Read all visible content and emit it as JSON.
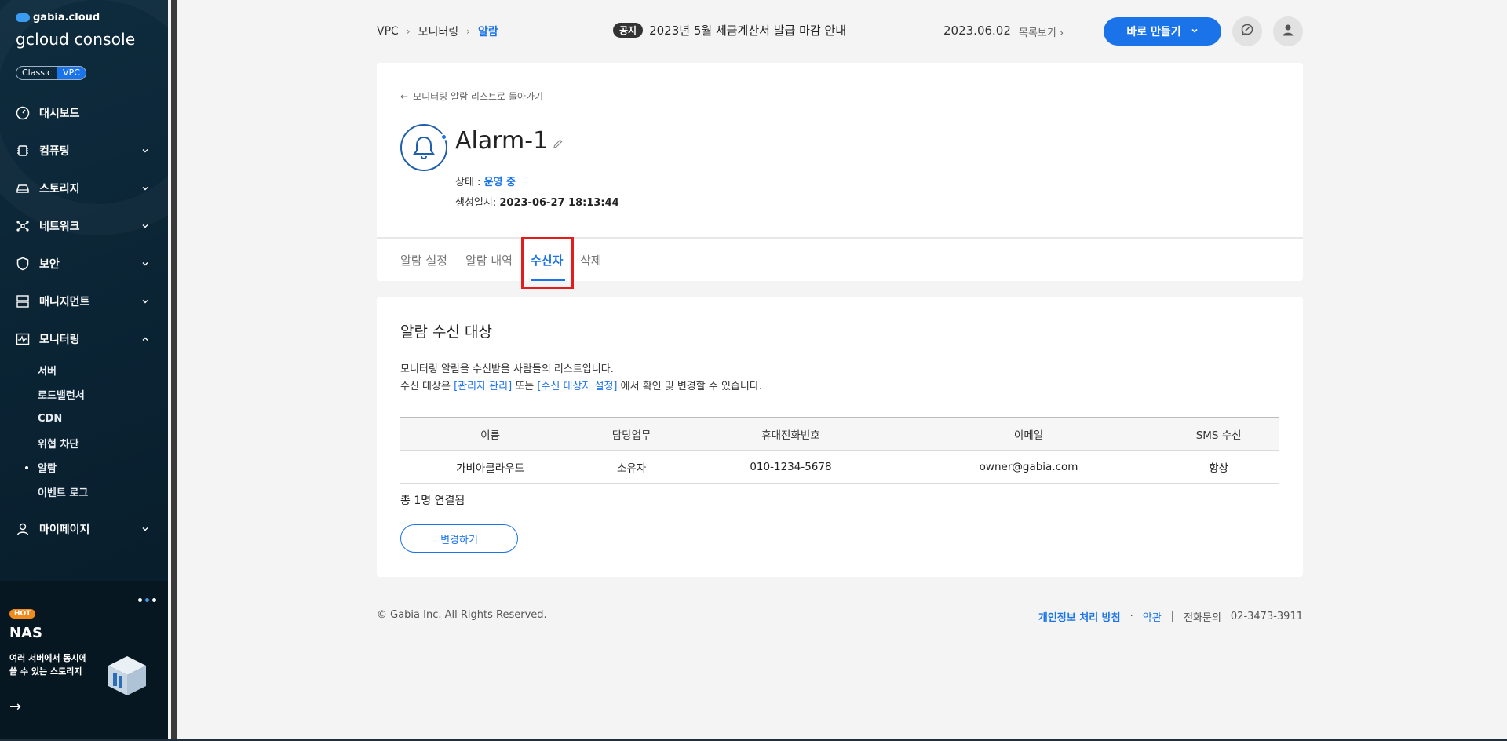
{
  "brand": {
    "top": "gabia.cloud",
    "main": "gcloud console"
  },
  "mode_toggle": {
    "classic": "Classic",
    "vpc": "VPC"
  },
  "sidebar": {
    "items": [
      {
        "label": "대시보드",
        "icon": "dashboard-icon"
      },
      {
        "label": "컴퓨팅",
        "icon": "chip-icon"
      },
      {
        "label": "스토리지",
        "icon": "storage-icon"
      },
      {
        "label": "네트워크",
        "icon": "network-icon"
      },
      {
        "label": "보안",
        "icon": "shield-icon"
      },
      {
        "label": "매니지먼트",
        "icon": "management-icon"
      },
      {
        "label": "모니터링",
        "icon": "monitoring-icon"
      }
    ],
    "monitoring_sub": [
      "서버",
      "로드밸런서",
      "CDN",
      "위협 차단",
      "알람",
      "이벤트 로그"
    ],
    "mypage": "마이페이지"
  },
  "promo": {
    "badge": "HOT",
    "title": "NAS",
    "desc_line1": "여러 서버에서 동시에",
    "desc_line2": "쓸 수 있는 스토리지",
    "arrow": "→"
  },
  "header": {
    "breadcrumb": [
      "VPC",
      "모니터링",
      "알람"
    ],
    "notice_tag": "공지",
    "notice_text": "2023년 5월 세금계산서 발급 마감 안내",
    "notice_date": "2023.06.02",
    "list_link": "목록보기",
    "make_button": "바로 만들기"
  },
  "detail": {
    "back_link": "모니터링 알람 리스트로 돌아가기",
    "title": "Alarm-1",
    "status_label": "상태 :",
    "status_value": "운영 중",
    "created_label": "생성일시:",
    "created_value": "2023-06-27 18:13:44",
    "tabs": [
      "알람 설정",
      "알람 내역",
      "수신자",
      "삭제"
    ]
  },
  "recipients": {
    "title": "알람 수신 대상",
    "desc1": "모니터링 알림을 수신받을 사람들의 리스트입니다.",
    "desc2_prefix": "수신 대상은",
    "desc2_link1": "[관리자 관리]",
    "desc2_mid": "또는",
    "desc2_link2": "[수신 대상자 설정]",
    "desc2_suffix": "에서 확인 및 변경할 수 있습니다.",
    "columns": [
      "이름",
      "담당업무",
      "휴대전화번호",
      "이메일",
      "SMS 수신"
    ],
    "rows": [
      [
        "가비아클라우드",
        "소유자",
        "010-1234-5678",
        "owner@gabia.com",
        "항상"
      ]
    ],
    "total": "총 1명 연결됨",
    "change_button": "변경하기"
  },
  "footer": {
    "copyright": "© Gabia Inc. All Rights Reserved.",
    "privacy": "개인정보 처리 방침",
    "dot": "·",
    "terms": "약관",
    "bar": "|",
    "phone_label": "전화문의",
    "phone": "02-3473-3911"
  },
  "colors": {
    "accent": "#1a73e8",
    "sidebar_bg": "#0b2433",
    "highlight": "#e31d1d"
  }
}
